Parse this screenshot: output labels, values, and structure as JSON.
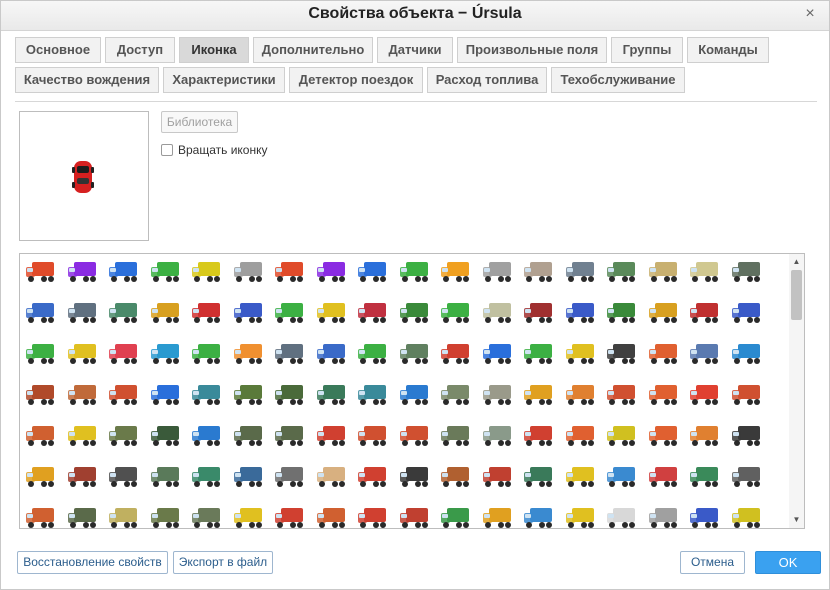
{
  "window": {
    "title": "Свойства объекта − Úrsula"
  },
  "tabs": [
    {
      "label": "Основное"
    },
    {
      "label": "Доступ"
    },
    {
      "label": "Иконка",
      "active": true
    },
    {
      "label": "Дополнительно"
    },
    {
      "label": "Датчики"
    },
    {
      "label": "Произвольные поля"
    },
    {
      "label": "Группы"
    },
    {
      "label": "Команды"
    },
    {
      "label": "Качество вождения"
    },
    {
      "label": "Характеристики"
    },
    {
      "label": "Детектор поездок"
    },
    {
      "label": "Расход топлива"
    },
    {
      "label": "Техобслуживание"
    }
  ],
  "icon_panel": {
    "library_button": "Библиотека",
    "rotate_label": "Вращать иконку",
    "rotate_checked": false,
    "current_icon": "red-car-icon"
  },
  "footer": {
    "restore_button": "Восстановление свойств",
    "export_button": "Экспорт в файл",
    "cancel_button": "Отмена",
    "ok_button": "OK"
  },
  "colors": {
    "ok_accent": "#3aa1f0",
    "link_blue": "#2b5d8c"
  },
  "icon_library": {
    "icon_name": "truck-icon",
    "rows": [
      [
        "#e04b2a",
        "#8a2be2",
        "#2a6fdb",
        "#3cb043",
        "#d8c91b",
        "#9e9e9e",
        "#e04b2a",
        "#8a2be2",
        "#2a6fdb",
        "#3cb043",
        "#f0a020",
        "#a0a0a0",
        "#b0a090",
        "#708090",
        "#5a8a5a",
        "#c8b070",
        "#d0c890",
        "#607060"
      ],
      [
        "#3a6ac8",
        "#607080",
        "#4a8a6a",
        "#d8a020",
        "#d03030",
        "#3a5ac8",
        "#3cb043",
        "#e0c020",
        "#c03040",
        "#3a8a3a",
        "#3cb043",
        "#c0c0a0",
        "#a03030",
        "#3a5ac8",
        "#3a8a3a",
        "#d8a020",
        "#c03030",
        "#3a5ac8"
      ],
      [
        "#3cb043",
        "#e0c020",
        "#e04050",
        "#2a9ad0",
        "#3cb043",
        "#f09030",
        "#607080",
        "#3a6ac8",
        "#3cb043",
        "#608060",
        "#d04030",
        "#2a6fdb",
        "#3cb043",
        "#e0c020",
        "#404040",
        "#e06030",
        "#5a7ab0",
        "#2a8ad0"
      ],
      [
        "#b04a2a",
        "#c06a3a",
        "#d05030",
        "#2a6fdb",
        "#3a8a9a",
        "#5a7a3a",
        "#4a6a3a",
        "#3a7a5a",
        "#3a8a9a",
        "#2a7ad0",
        "#7a8a6a",
        "#9a9a8a",
        "#e0a020",
        "#e08030",
        "#d05030",
        "#e06030",
        "#e04030",
        "#d05030"
      ],
      [
        "#d06030",
        "#e0c020",
        "#6a7a4a",
        "#3a5a3a",
        "#2a7ad0",
        "#5a6a4a",
        "#5a6a4a",
        "#d04030",
        "#d05030",
        "#d05030",
        "#6a7a5a",
        "#8a9a8a",
        "#d04030",
        "#e06030",
        "#d0c020",
        "#e06030",
        "#e08030",
        "#3a3a3a"
      ],
      [
        "#e0a020",
        "#a04030",
        "#505050",
        "#5a7a5a",
        "#3a8a6a",
        "#3a6a9a",
        "#707070",
        "#d8b080",
        "#d04030",
        "#3a3a3a",
        "#b06030",
        "#c04030",
        "#3a7a5a",
        "#e0c020",
        "#3a8ad0",
        "#d04040",
        "#3a8a5a",
        "#606060"
      ],
      [
        "#d06030",
        "#5a6a4a",
        "#c0b060",
        "#6a7a4a",
        "#6a7a5a",
        "#e0c020",
        "#d04030",
        "#d06030",
        "#d04030",
        "#c04030",
        "#3a9a4a",
        "#e0a020",
        "#3a8ad0",
        "#e0c020",
        "#d8d8d8",
        "#a0a0a0",
        "#3a5ac8",
        "#d0c020"
      ]
    ]
  }
}
